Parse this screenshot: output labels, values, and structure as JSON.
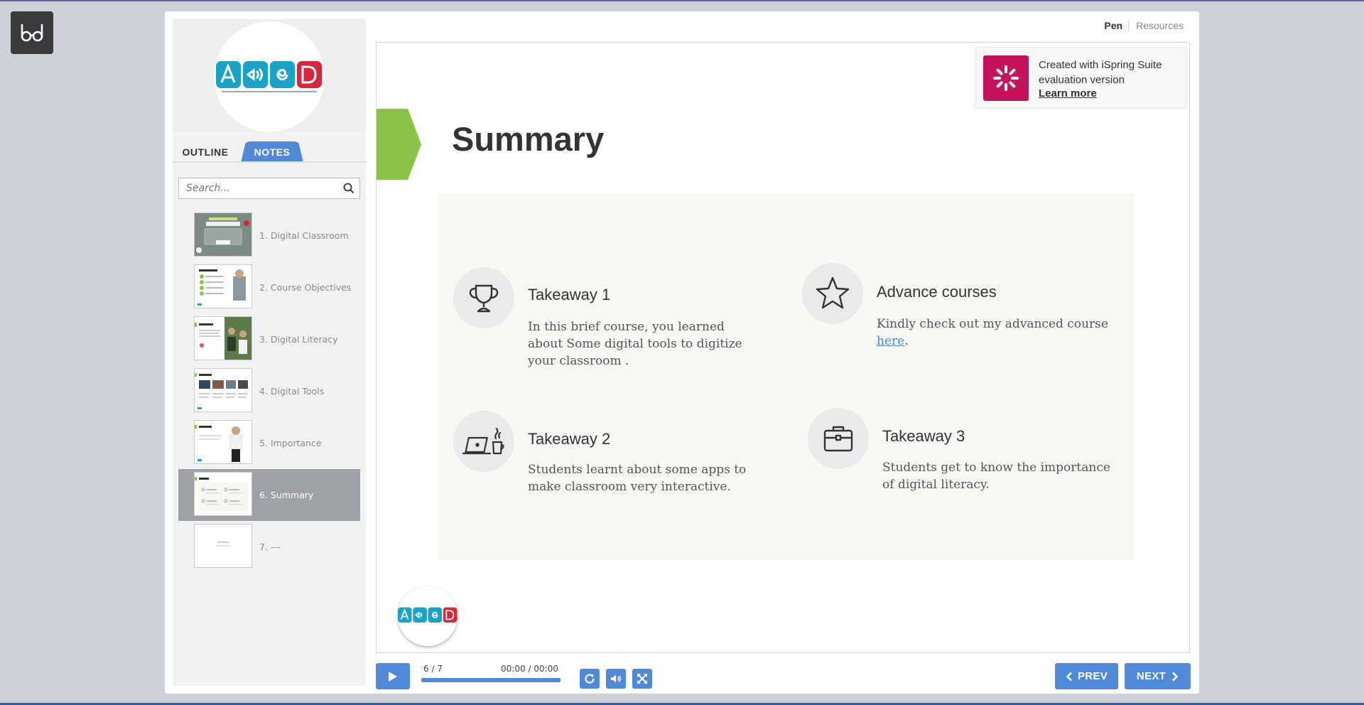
{
  "reader": {
    "icon": "glasses-icon"
  },
  "topnav": {
    "pen": "Pen",
    "resources": "Resources"
  },
  "sidebar": {
    "tabs": {
      "outline": "OUTLINE",
      "notes": "NOTES"
    },
    "search_placeholder": "Search...",
    "items": [
      {
        "label": "1. Digital Classroom"
      },
      {
        "label": "2. Course Objectives"
      },
      {
        "label": "3. Digital Literacy"
      },
      {
        "label": "4. Digital Tools"
      },
      {
        "label": "5. Importance"
      },
      {
        "label": "6. Summary",
        "active": true
      },
      {
        "label": "7. ---"
      }
    ]
  },
  "slide": {
    "title": "Summary",
    "takeaways": [
      {
        "title": "Takeaway 1",
        "text": "In this brief course, you learned about Some digital tools to digitize your classroom .",
        "icon": "trophy-icon"
      },
      {
        "title": "Advance courses",
        "text": "Kindly check out my advanced course ",
        "link": "here",
        "text_after": ".",
        "icon": "star-icon"
      },
      {
        "title": "Takeaway 2",
        "text": "Students learnt about some apps to make classroom very interactive.",
        "icon": "laptop-coffee-icon"
      },
      {
        "title": "Takeaway 3",
        "text": "Students get to know the importance of digital literacy.",
        "icon": "briefcase-icon"
      }
    ]
  },
  "banner": {
    "line1": "Created with iSpring Suite evaluation version",
    "learn_more": "Learn more"
  },
  "controls": {
    "slide_number": "6 / 7",
    "time": "00:00 / 00:00",
    "progress": 1.0,
    "prev": "PREV",
    "next": "NEXT"
  },
  "colors": {
    "accent": "#4f89d8",
    "green": "#8bc34a",
    "ispring": "#c4145b"
  }
}
